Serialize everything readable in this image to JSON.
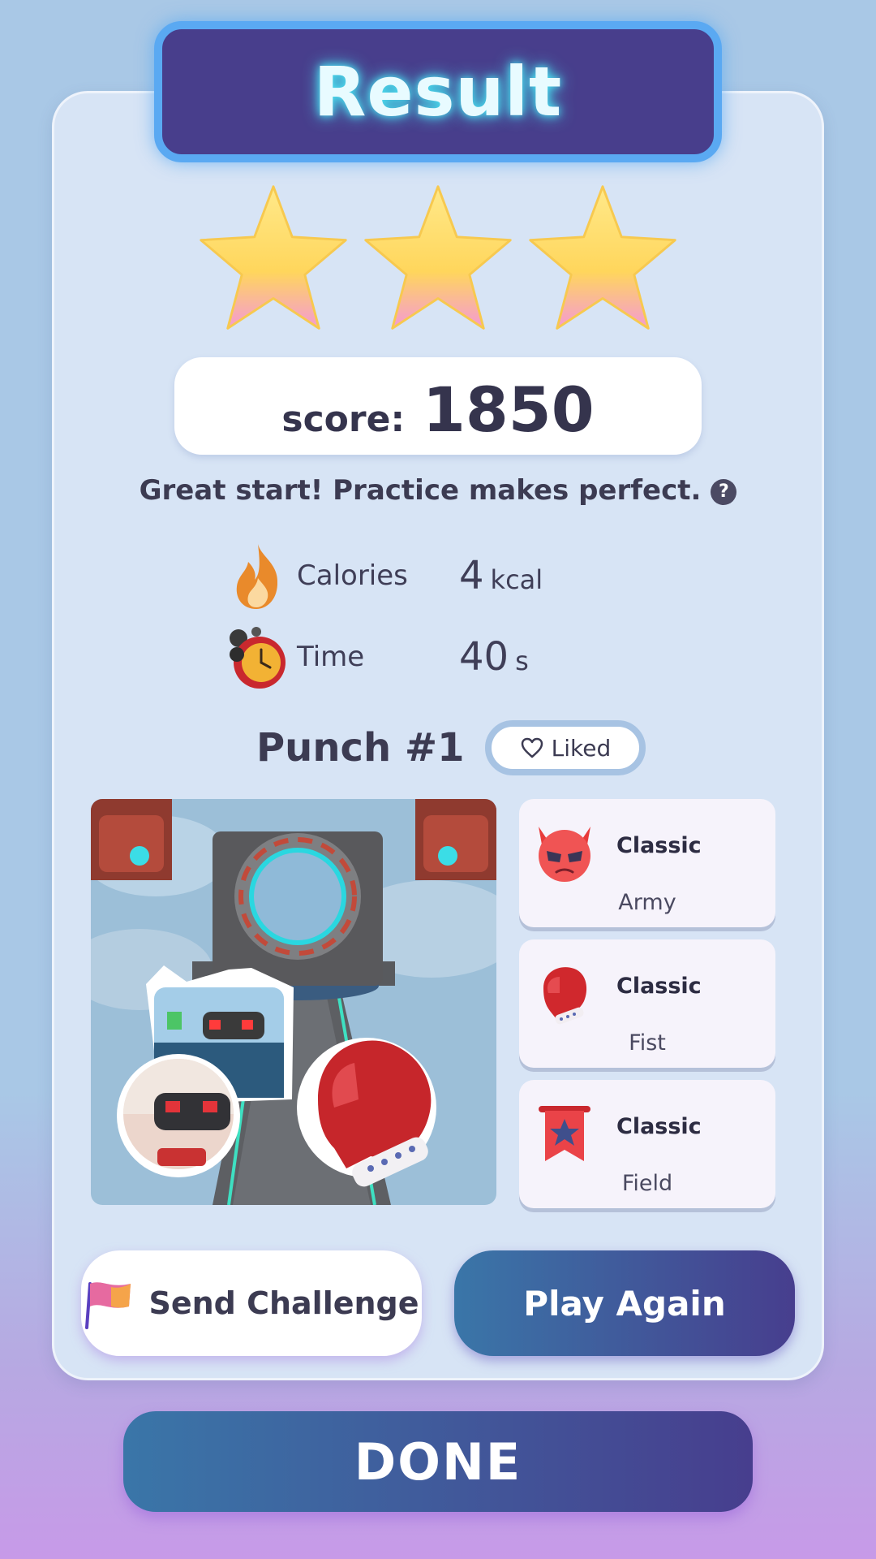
{
  "header": {
    "title": "Result"
  },
  "rating": {
    "stars_earned": 3,
    "stars_total": 3
  },
  "score": {
    "label": "score:",
    "value": "1850"
  },
  "message": "Great start! Practice makes perfect.",
  "stats": [
    {
      "label": "Calories",
      "value": "4",
      "unit": "kcal",
      "icon": "fire-icon"
    },
    {
      "label": "Time",
      "value": "40",
      "unit": "s",
      "icon": "alarm-clock-icon"
    }
  ],
  "song": {
    "title": "Punch #1",
    "liked_label": "Liked"
  },
  "modifiers": [
    {
      "type": "Classic",
      "name": "Army",
      "icon": "devil-icon"
    },
    {
      "type": "Classic",
      "name": "Fist",
      "icon": "boxing-glove-icon"
    },
    {
      "type": "Classic",
      "name": "Field",
      "icon": "banner-icon"
    }
  ],
  "buttons": {
    "send_challenge": "Send Challenge",
    "play_again": "Play Again",
    "done": "DONE"
  },
  "colors": {
    "primary": "#473e8e",
    "accent_glow": "#5aa9f2",
    "star_yellow": "#ffe27a",
    "star_pink": "#f6a3d6",
    "card_bg": "#d7e4f5"
  }
}
